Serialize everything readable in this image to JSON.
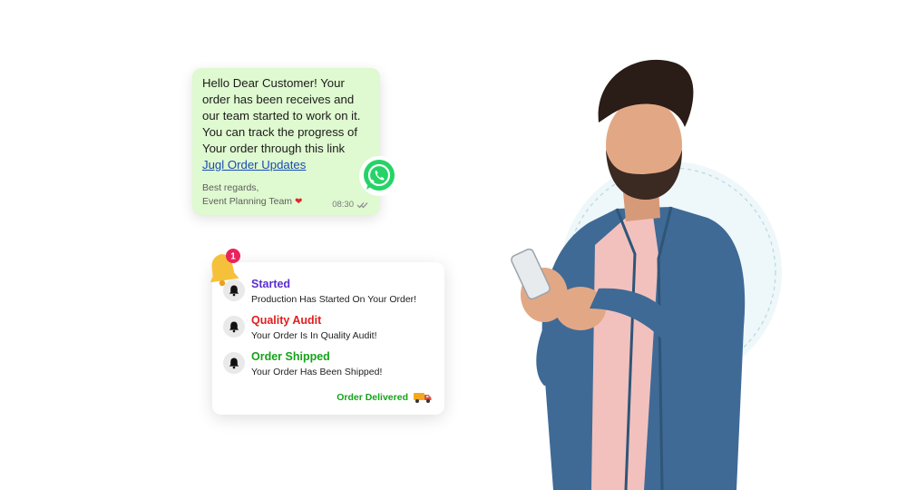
{
  "whatsapp_message": {
    "body": "Hello Dear Customer! Your order has been receives and our team started to work on it. You can track the progress of Your order through this link",
    "link_text": "Jugl Order Updates",
    "sign_line1": "Best regards,",
    "sign_line2": "Event Planning Team",
    "time": "08:30",
    "bubble_color": "#dff9d0",
    "icon": "whatsapp-icon"
  },
  "notifications": {
    "badge_count": "1",
    "items": [
      {
        "title": "Started",
        "description": "Production Has Started On Your Order!",
        "color": "#5a2fd1"
      },
      {
        "title": "Quality Audit",
        "description": "Your Order Is In Quality Audit!",
        "color": "#e01e1e"
      },
      {
        "title": "Order Shipped",
        "description": "Your Order Has Been Shipped!",
        "color": "#16a21a"
      }
    ],
    "footer": "Order Delivered",
    "footer_icon": "delivery-truck-icon"
  }
}
